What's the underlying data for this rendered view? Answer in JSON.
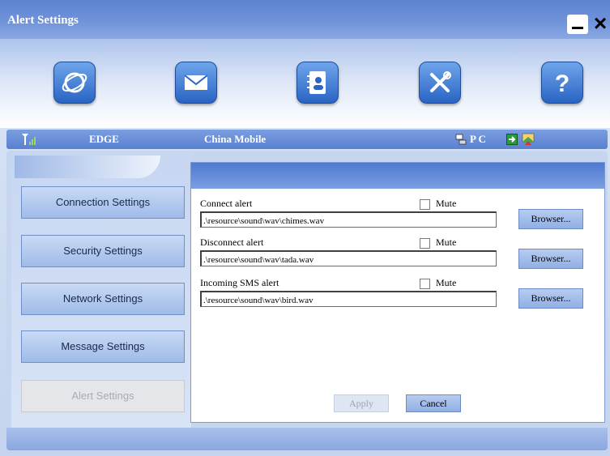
{
  "window": {
    "title": "Alert Settings"
  },
  "toolbar": {
    "icons": [
      "internet-icon",
      "mail-icon",
      "contacts-icon",
      "tools-icon",
      "help-icon"
    ]
  },
  "status": {
    "network_type": "EDGE",
    "operator": "China Mobile",
    "pc_label": "P C"
  },
  "sidebar": {
    "items": [
      {
        "label": "Connection Settings"
      },
      {
        "label": "Security Settings"
      },
      {
        "label": "Network Settings"
      },
      {
        "label": "Message Settings"
      },
      {
        "label": "Alert Settings"
      }
    ]
  },
  "alerts": [
    {
      "label": "Connect alert",
      "mute_label": "Mute",
      "muted": false,
      "path": ".\\resource\\sound\\wav\\chimes.wav",
      "browse_label": "Browser..."
    },
    {
      "label": "Disconnect alert",
      "mute_label": "Mute",
      "muted": false,
      "path": ".\\resource\\sound\\wav\\tada.wav",
      "browse_label": "Browser..."
    },
    {
      "label": "Incoming SMS alert",
      "mute_label": "Mute",
      "muted": false,
      "path": ".\\resource\\sound\\wav\\bird.wav",
      "browse_label": "Browser..."
    }
  ],
  "actions": {
    "apply_label": "Apply",
    "cancel_label": "Cancel"
  },
  "colors": {
    "accent": "#5e83cf",
    "button": "#9fbbe8",
    "icon": "#2a64c4"
  }
}
